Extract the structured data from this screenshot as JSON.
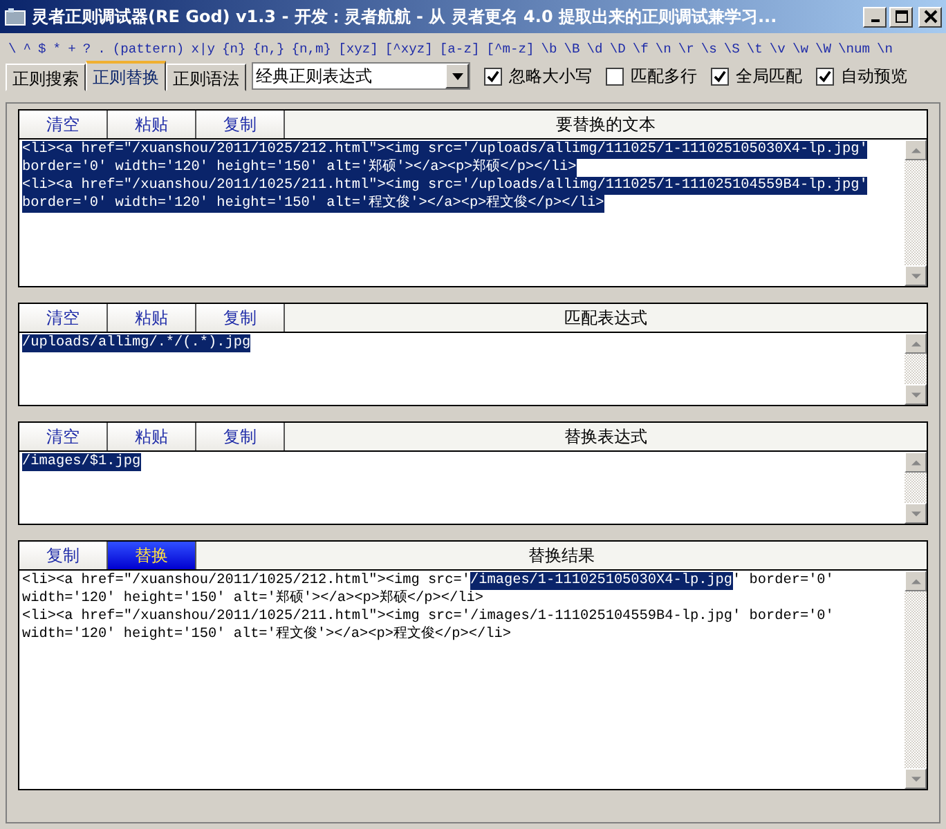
{
  "window": {
    "title": "灵者正则调试器(RE God) v1.3 - 开发：灵者航航 - 从 灵者更名 4.0 提取出来的正则调试兼学习..."
  },
  "syntax_tokens": [
    "\\",
    "^",
    "$",
    "*",
    "+",
    "?",
    ".",
    "(pattern)",
    "x|y",
    "{n}",
    "{n,}",
    "{n,m}",
    "[xyz]",
    "[^xyz]",
    "[a-z]",
    "[^m-z]",
    "\\b",
    "\\B",
    "\\d",
    "\\D",
    "\\f",
    "\\n",
    "\\r",
    "\\s",
    "\\S",
    "\\t",
    "\\v",
    "\\w",
    "\\W",
    "\\num",
    "\\n"
  ],
  "tabs": [
    {
      "label": "正则搜索",
      "selected": false
    },
    {
      "label": "正则替换",
      "selected": true
    },
    {
      "label": "正则语法",
      "selected": false
    }
  ],
  "preset_dropdown": {
    "value": "经典正则表达式"
  },
  "options": [
    {
      "label": "忽略大小写",
      "checked": true
    },
    {
      "label": "匹配多行",
      "checked": false
    },
    {
      "label": "全局匹配",
      "checked": true
    },
    {
      "label": "自动预览",
      "checked": true
    }
  ],
  "sections": [
    {
      "title": "要替换的文本",
      "buttons": [
        {
          "label": "清空",
          "selected": false
        },
        {
          "label": "粘贴",
          "selected": false
        },
        {
          "label": "复制",
          "selected": false
        }
      ],
      "lines": [
        [
          {
            "text": "<li><a href=\"/xuanshou/2011/1025/212.html\"><img src='/uploads/allimg/111025/1-111025105030X4-lp.jpg'",
            "selected": true
          }
        ],
        [
          {
            "text": "border='0' width='120' height='150' alt='郑硕'></a><p>郑硕</p></li>",
            "selected": true
          }
        ],
        [
          {
            "text": "<li><a href=\"/xuanshou/2011/1025/211.html\"><img src='/uploads/allimg/111025/1-111025104559B4-lp.jpg'",
            "selected": true
          }
        ],
        [
          {
            "text": "border='0' width='120' height='150' alt='程文俊'></a><p>程文俊</p></li>",
            "selected": true
          }
        ]
      ]
    },
    {
      "title": "匹配表达式",
      "buttons": [
        {
          "label": "清空",
          "selected": false
        },
        {
          "label": "粘贴",
          "selected": false
        },
        {
          "label": "复制",
          "selected": false
        }
      ],
      "lines": [
        [
          {
            "text": "/uploads/allimg/.*/(.*).jpg",
            "selected": true
          }
        ]
      ]
    },
    {
      "title": "替换表达式",
      "buttons": [
        {
          "label": "清空",
          "selected": false
        },
        {
          "label": "粘贴",
          "selected": false
        },
        {
          "label": "复制",
          "selected": false
        }
      ],
      "lines": [
        [
          {
            "text": "/images/$1.jpg",
            "selected": true
          }
        ]
      ]
    },
    {
      "title": "替换结果",
      "buttons": [
        {
          "label": "复制",
          "selected": false
        },
        {
          "label": "替换",
          "selected": true
        }
      ],
      "lines": [
        [
          {
            "text": "<li><a href=\"/xuanshou/2011/1025/212.html\"><img src='",
            "selected": false
          },
          {
            "text": "/images/1-111025105030X4-lp.jpg",
            "selected": true
          },
          {
            "text": "' border='0'",
            "selected": false
          }
        ],
        [
          {
            "text": "width='120' height='150' alt='郑硕'></a><p>郑硕</p></li>",
            "selected": false
          }
        ],
        [
          {
            "text": "<li><a href=\"/xuanshou/2011/1025/211.html\"><img src='/images/1-111025104559B4-lp.jpg' border='0'",
            "selected": false
          }
        ],
        [
          {
            "text": "width='120' height='150' alt='程文俊'></a><p>程文俊</p></li>",
            "selected": false
          }
        ]
      ]
    }
  ]
}
